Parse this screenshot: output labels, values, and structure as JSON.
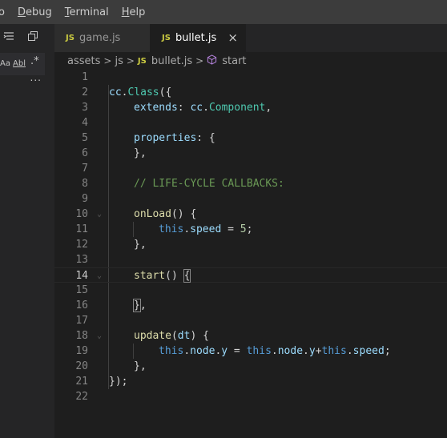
{
  "menu": {
    "items": [
      {
        "pre": "",
        "ul": "",
        "post": "o"
      },
      {
        "pre": "",
        "ul": "D",
        "post": "ebug"
      },
      {
        "pre": "",
        "ul": "T",
        "post": "erminal"
      },
      {
        "pre": "",
        "ul": "H",
        "post": "elp"
      }
    ]
  },
  "side": {
    "opt_case": "Aa",
    "opt_word": "Abl",
    "opt_regex": ".*",
    "more": "..."
  },
  "tabs": [
    {
      "badge": "JS",
      "label": "game.js",
      "active": false
    },
    {
      "badge": "JS",
      "label": "bullet.js",
      "active": true,
      "close": "×"
    }
  ],
  "breadcrumb": {
    "seg1": "assets",
    "seg2": "js",
    "badge": "JS",
    "seg3": "bullet.js",
    "seg4": "start",
    "sep": ">"
  },
  "editor": {
    "line_numbers": [
      "1",
      "2",
      "3",
      "4",
      "5",
      "6",
      "7",
      "8",
      "9",
      "10",
      "11",
      "12",
      "13",
      "14",
      "15",
      "16",
      "17",
      "18",
      "19",
      "20",
      "21",
      "22"
    ],
    "code": {
      "l2_a": "cc",
      "l2_b": ".",
      "l2_c": "Class",
      "l2_d": "({",
      "l3_a": "extends",
      "l3_b": ": ",
      "l3_c": "cc",
      "l3_d": ".",
      "l3_e": "Component",
      "l3_f": ",",
      "l5_a": "properties",
      "l5_b": ": {",
      "l6_a": "},",
      "l8_a": "// LIFE-CYCLE CALLBACKS:",
      "l10_a": "onLoad",
      "l10_b": "() {",
      "l11_a": "this",
      "l11_b": ".",
      "l11_c": "speed",
      "l11_d": " = ",
      "l11_e": "5",
      "l11_f": ";",
      "l12_a": "},",
      "l14_a": "start",
      "l14_b": "() ",
      "l14_c": "{",
      "l16_a": "}",
      "l16_b": ",",
      "l18_a": "update",
      "l18_b": "(",
      "l18_c": "dt",
      "l18_d": ") {",
      "l19_a": "this",
      "l19_b": ".",
      "l19_c": "node",
      "l19_d": ".",
      "l19_e": "y",
      "l19_f": " = ",
      "l19_g": "this",
      "l19_h": ".",
      "l19_i": "node",
      "l19_j": ".",
      "l19_k": "y",
      "l19_l": "+",
      "l19_m": "this",
      "l19_n": ".",
      "l19_o": "speed",
      "l19_p": ";",
      "l20_a": "},",
      "l21_a": "});"
    }
  }
}
